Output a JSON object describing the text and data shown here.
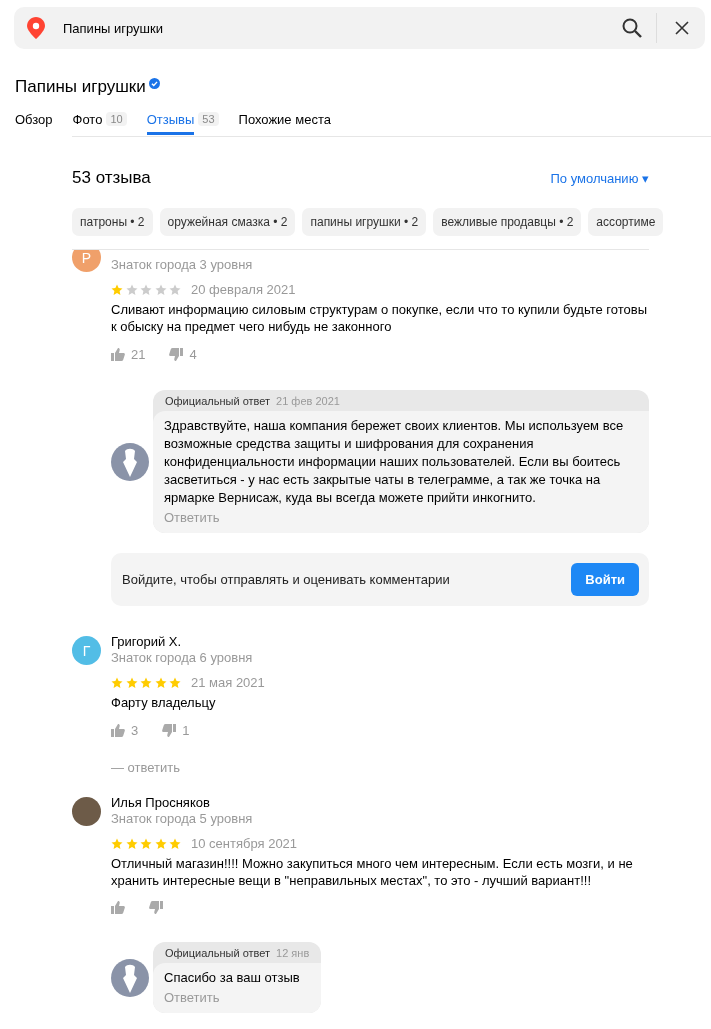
{
  "search": {
    "value": "Папины игрушки"
  },
  "place": {
    "title": "Папины игрушки",
    "verified": true
  },
  "tabs": [
    {
      "label": "Обзор",
      "selected": false
    },
    {
      "label": "Фото",
      "count": "10",
      "selected": false
    },
    {
      "label": "Отзывы",
      "count": "53",
      "selected": true
    },
    {
      "label": "Похожие места",
      "selected": false
    }
  ],
  "reviews_header": {
    "title": "53 отзыва",
    "sort": "По умолчанию ▾"
  },
  "tags": [
    "патроны • 2",
    "оружейная смазка • 2",
    "папины игрушки • 2",
    "вежливые продавцы • 2",
    "ассортиме"
  ],
  "feed": [
    {
      "kind": "review",
      "avatar": {
        "kind": "letter",
        "letter": "P",
        "color": "#f0a06a"
      },
      "level": "Знаток города 3 уровня",
      "stars": 1,
      "date": "20 февраля 2021",
      "text": "Сливают информацию силовым структурам о покупке, если что то купили будьте готовы к обыску на предмет чего нибудь не законного",
      "likes": "21",
      "dislikes": "4",
      "answer": {
        "label": "Официальный ответ",
        "date": "21 фев 2021",
        "text": "Здравствуйте, наша компания бережет своих клиентов. Мы используем все возможные средства защиты и шифрования для сохранения конфиденциальности информации наших пользователей. Если вы боитесь засветиться - у нас есть закрытые чаты в телеграмме, а так же точка на ярмарке Вернисаж, куда вы всегда можете прийти инкогнито.",
        "reply": "Ответить"
      }
    },
    {
      "kind": "login_prompt",
      "text": "Войдите, чтобы отправлять и оценивать комментарии",
      "button": "Войти"
    },
    {
      "kind": "review",
      "name": "Григорий Х.",
      "avatar": {
        "kind": "letter",
        "letter": "Г",
        "color": "#52bde6"
      },
      "level": "Знаток города 6 уровня",
      "stars": 5,
      "date": "21 мая 2021",
      "text": "Фарту владельцу",
      "likes": "3",
      "dislikes": "1",
      "reply_link": "— ответить"
    },
    {
      "kind": "review",
      "name": "Илья Просняков",
      "avatar": {
        "kind": "photo"
      },
      "level": "Знаток города 5 уровня",
      "stars": 5,
      "date": "10 сентября 2021",
      "text": "Отличный магазин!!!! Можно закупиться много чем интересным. Если есть мозги, и не хранить интересные вещи в \"неправильных местах\", то это - лучший вариант!!!",
      "answer": {
        "label": "Официальный ответ",
        "date": "12 янв",
        "text": "Спасибо за ваш отзыв",
        "reply": "Ответить"
      }
    }
  ]
}
